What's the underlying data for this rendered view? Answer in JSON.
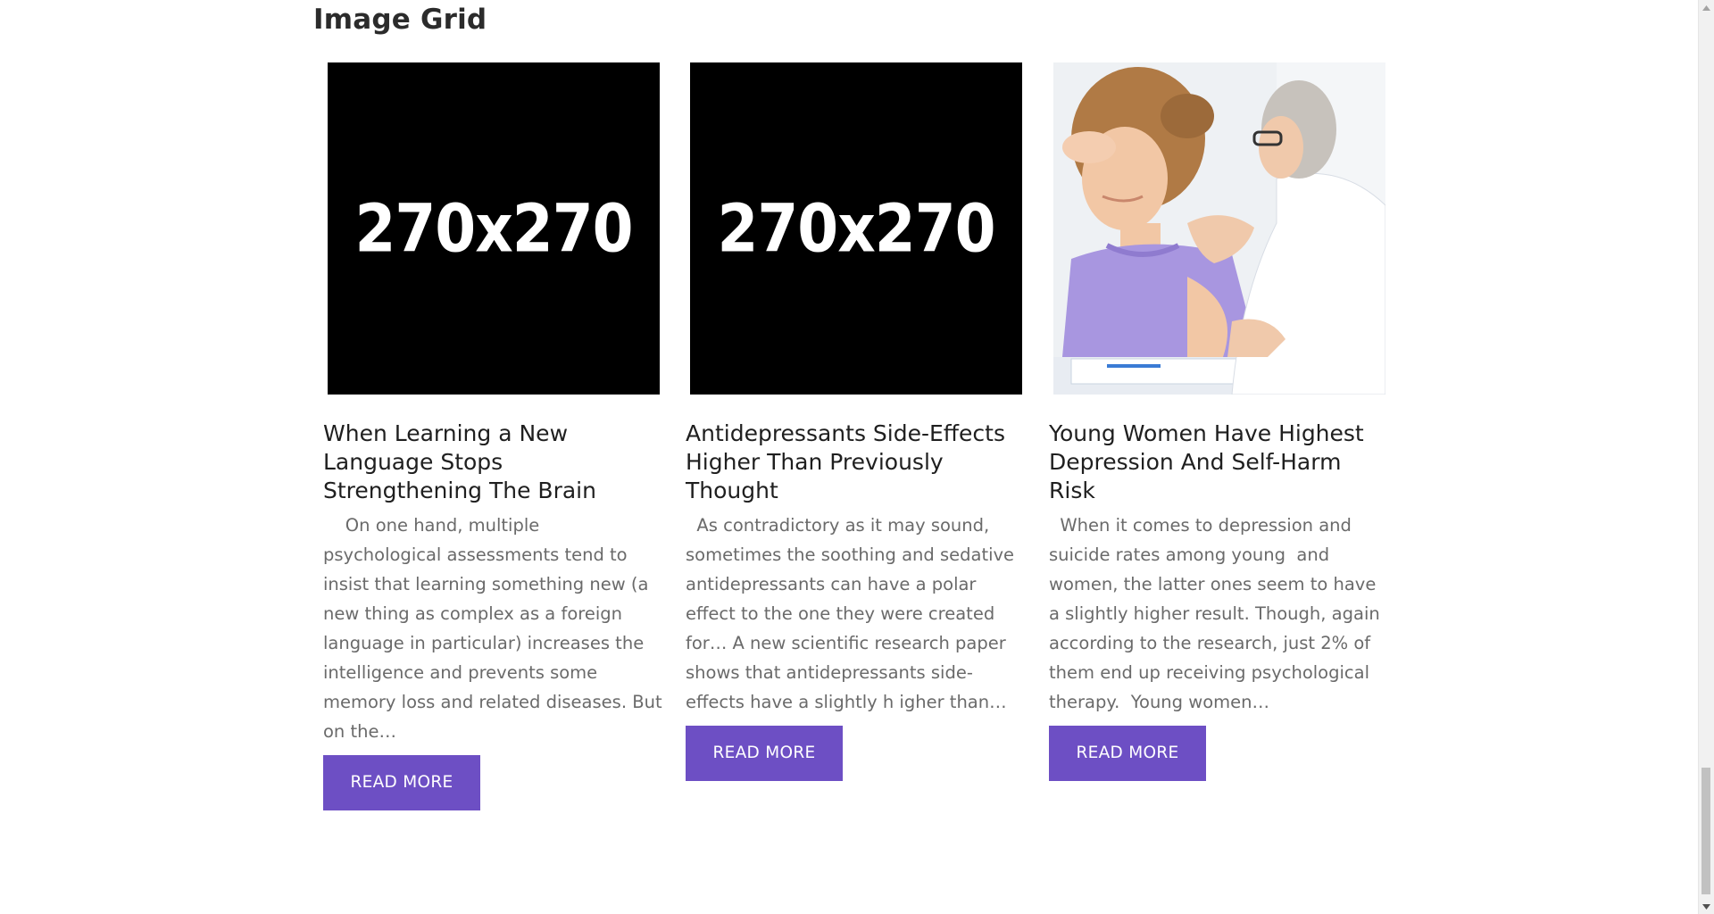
{
  "section": {
    "title": "Image Grid"
  },
  "cards": [
    {
      "image_label": "270x270",
      "title": "When Learning a New Language Stops Strengthening The Brain",
      "excerpt": "    On one hand, multiple psychological assessments tend to insist that learning something new (a new thing as complex as a foreign language in particular) increases the intelligence and prevents some memory loss and related diseases. But on the…",
      "button_label": "READ MORE"
    },
    {
      "image_label": "270x270",
      "title": "Antidepressants Side-Effects Higher Than Previously Thought",
      "excerpt": "  As contradictory as it may sound, sometimes the soothing and sedative antidepressants can have a polar effect to the one they were created for… A new scientific research paper shows that antidepressants side-effects have a slightly h igher than…",
      "button_label": "READ MORE"
    },
    {
      "image_label": "",
      "title": "Young Women Have Highest Depression And Self-Harm Risk",
      "excerpt": "  When it comes to depression and suicide rates among young  and women, the latter ones seem to have a slightly higher result. Though, again according to the research, just 2% of them end up receiving psychological therapy.  Young women…",
      "button_label": "READ MORE"
    }
  ],
  "colors": {
    "button_bg": "#6d4fc4",
    "title_text": "#1f1f1f",
    "excerpt_text": "#6a6a6a"
  }
}
